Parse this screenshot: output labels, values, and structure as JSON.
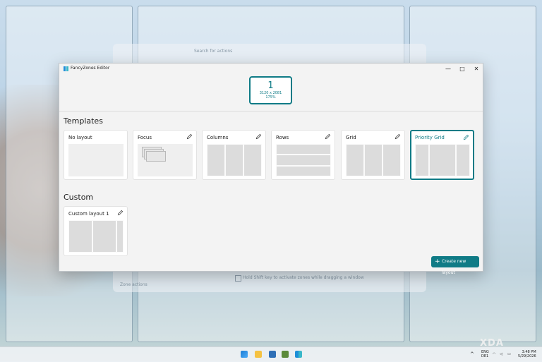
{
  "window": {
    "title": "FancyZones Editor",
    "controls": {
      "minimize": "—",
      "maximize": "□",
      "close": "✕"
    }
  },
  "monitor": {
    "number": "1",
    "resolution": "3120 x 2081",
    "scale": "175%"
  },
  "sections": {
    "templates_title": "Templates",
    "custom_title": "Custom"
  },
  "templates": [
    {
      "name": "No layout",
      "editable": false
    },
    {
      "name": "Focus",
      "editable": true
    },
    {
      "name": "Columns",
      "editable": true
    },
    {
      "name": "Rows",
      "editable": true
    },
    {
      "name": "Grid",
      "editable": true
    },
    {
      "name": "Priority Grid",
      "editable": true,
      "selected": true
    }
  ],
  "custom_layouts": [
    {
      "name": "Custom layout 1",
      "editable": true
    }
  ],
  "create_button": {
    "label": "Create new layout",
    "icon": "plus-icon"
  },
  "background": {
    "search_placeholder": "Search for actions",
    "checkbox_label": "Hold Shift key to activate zones while dragging a window",
    "footer_text": "Zone actions"
  },
  "taskbar": {
    "icons": [
      "windows-start-icon",
      "file-explorer-icon",
      "store-icon",
      "app-icon",
      "fancyzones-icon"
    ],
    "language_line1": "ENG",
    "language_line2": "DE1",
    "time": "3:48 PM",
    "date": "5/29/2026"
  },
  "watermark": "XDA",
  "colors": {
    "accent": "#0f7b86",
    "window_bg": "#f3f3f3",
    "card_bg": "#ffffff"
  }
}
